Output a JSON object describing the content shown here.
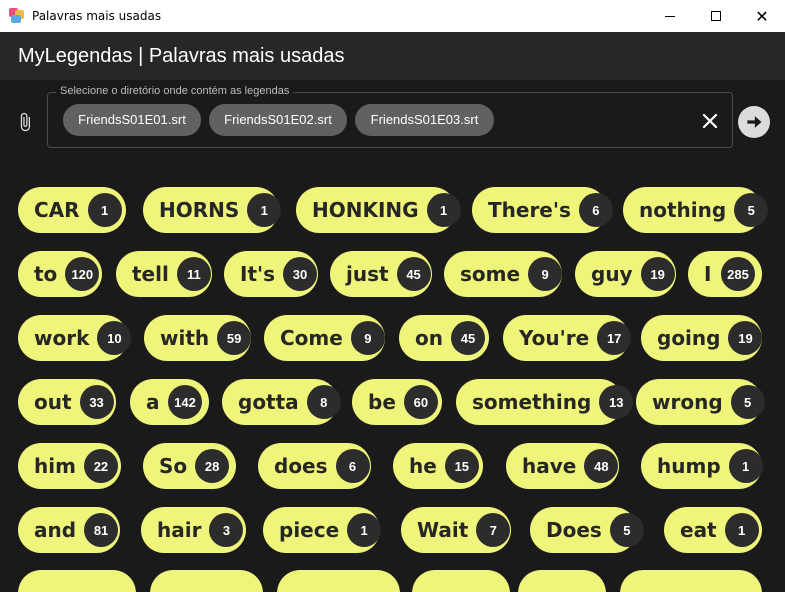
{
  "window": {
    "title": "Palavras mais usadas",
    "minimize_glyph": "",
    "maximize_glyph": "",
    "close_glyph": "✕"
  },
  "header": {
    "title": "MyLegendas | Palavras mais usadas"
  },
  "directory": {
    "label": "Selecione o diretório onde contém as legendas",
    "files": [
      "FriendsS01E01.srt",
      "FriendsS01E02.srt",
      "FriendsS01E03.srt"
    ],
    "icons": [
      "paperclip-icon",
      "close-icon",
      "arrow-right-icon"
    ]
  },
  "colors": {
    "chip_background": "#eef57a",
    "count_badge": "#2c2c2c",
    "file_chip": "#616161",
    "background": "#1a1a1a"
  },
  "words": [
    [
      {
        "word": "CAR",
        "count": "1"
      },
      {
        "word": "HORNS",
        "count": "1"
      },
      {
        "word": "HONKING",
        "count": "1"
      },
      {
        "word": "There's",
        "count": "6"
      },
      {
        "word": "nothing",
        "count": "5"
      }
    ],
    [
      {
        "word": "to",
        "count": "120"
      },
      {
        "word": "tell",
        "count": "11"
      },
      {
        "word": "It's",
        "count": "30"
      },
      {
        "word": "just",
        "count": "45"
      },
      {
        "word": "some",
        "count": "9"
      },
      {
        "word": "guy",
        "count": "19"
      },
      {
        "word": "I",
        "count": "285"
      }
    ],
    [
      {
        "word": "work",
        "count": "10"
      },
      {
        "word": "with",
        "count": "59"
      },
      {
        "word": "Come",
        "count": "9"
      },
      {
        "word": "on",
        "count": "45"
      },
      {
        "word": "You're",
        "count": "17"
      },
      {
        "word": "going",
        "count": "19"
      }
    ],
    [
      {
        "word": "out",
        "count": "33"
      },
      {
        "word": "a",
        "count": "142"
      },
      {
        "word": "gotta",
        "count": "8"
      },
      {
        "word": "be",
        "count": "60"
      },
      {
        "word": "something",
        "count": "13"
      },
      {
        "word": "wrong",
        "count": "5"
      }
    ],
    [
      {
        "word": "him",
        "count": "22"
      },
      {
        "word": "So",
        "count": "28"
      },
      {
        "word": "does",
        "count": "6"
      },
      {
        "word": "he",
        "count": "15"
      },
      {
        "word": "have",
        "count": "48"
      },
      {
        "word": "hump",
        "count": "1"
      }
    ],
    [
      {
        "word": "and",
        "count": "81"
      },
      {
        "word": "hair",
        "count": "3"
      },
      {
        "word": "piece",
        "count": "1"
      },
      {
        "word": "Wait",
        "count": "7"
      },
      {
        "word": "Does",
        "count": "5"
      },
      {
        "word": "eat",
        "count": "1"
      }
    ]
  ]
}
